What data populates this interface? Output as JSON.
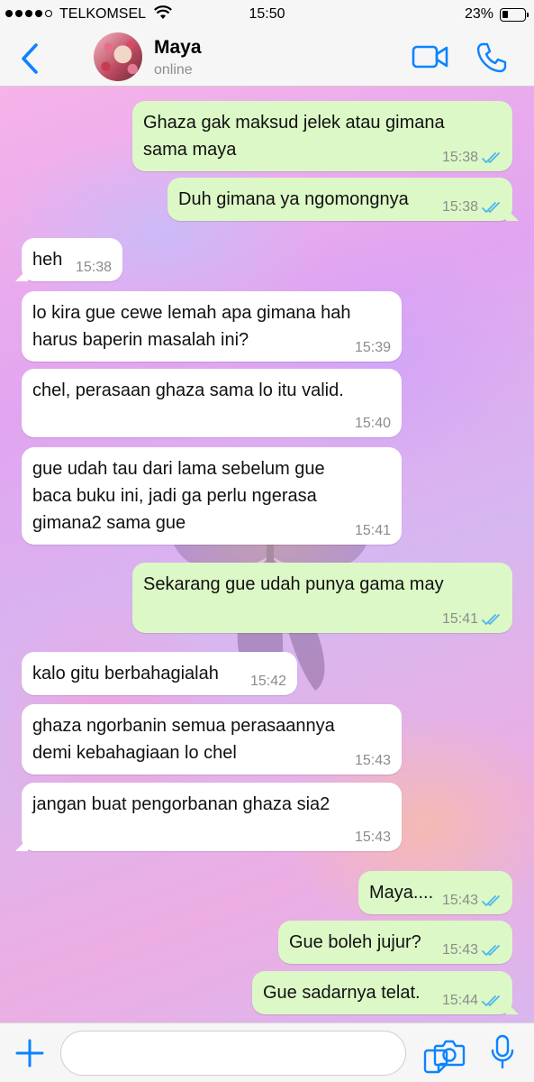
{
  "status_bar": {
    "carrier": "TELKOMSEL",
    "time": "15:50",
    "battery_percent": "23%",
    "battery_level": 0.23,
    "signal_bars": 4
  },
  "header": {
    "back_icon": "chevron-left-icon",
    "contact_name": "Maya",
    "contact_status": "online",
    "video_icon": "video-call-icon",
    "phone_icon": "phone-call-icon",
    "accent_color": "#0a84ff"
  },
  "messages": [
    {
      "direction": "out",
      "text": "Ghaza gak maksud jelek atau gimana\nsama maya",
      "time": "15:38",
      "read": true
    },
    {
      "direction": "out",
      "text": "Duh gimana ya ngomongnya",
      "time": "15:38",
      "read": true
    },
    {
      "direction": "in",
      "text": "heh",
      "time": "15:38"
    },
    {
      "direction": "in",
      "text": "lo kira gue cewe lemah apa gimana hah\nharus baperin masalah ini?",
      "time": "15:39"
    },
    {
      "direction": "in",
      "text": "chel, perasaan ghaza sama lo itu valid.",
      "time": "15:40"
    },
    {
      "direction": "in",
      "text": "gue udah tau dari lama sebelum gue\nbaca buku ini, jadi ga perlu ngerasa\ngimana2 sama gue",
      "time": "15:41"
    },
    {
      "direction": "out",
      "text": "Sekarang gue udah punya gama may",
      "time": "15:41",
      "read": true
    },
    {
      "direction": "in",
      "text": "kalo gitu berbahagialah",
      "time": "15:42"
    },
    {
      "direction": "in",
      "text": "ghaza ngorbanin semua perasaannya\ndemi kebahagiaan lo chel",
      "time": "15:43"
    },
    {
      "direction": "in",
      "text": "jangan buat pengorbanan ghaza sia2",
      "time": "15:43"
    },
    {
      "direction": "out",
      "text": "Maya....",
      "time": "15:43",
      "read": true
    },
    {
      "direction": "out",
      "text": "Gue boleh jujur?",
      "time": "15:43",
      "read": true
    },
    {
      "direction": "out",
      "text": "Gue sadarnya telat.",
      "time": "15:44",
      "read": true
    }
  ],
  "input_bar": {
    "plus_icon": "plus-icon",
    "placeholder": "",
    "sticker_icon": "sticker-icon",
    "camera_icon": "camera-icon",
    "mic_icon": "microphone-icon"
  },
  "colors": {
    "outgoing_bubble": "#dcf8c6",
    "incoming_bubble": "#ffffff",
    "read_ticks": "#4fb6ec"
  }
}
